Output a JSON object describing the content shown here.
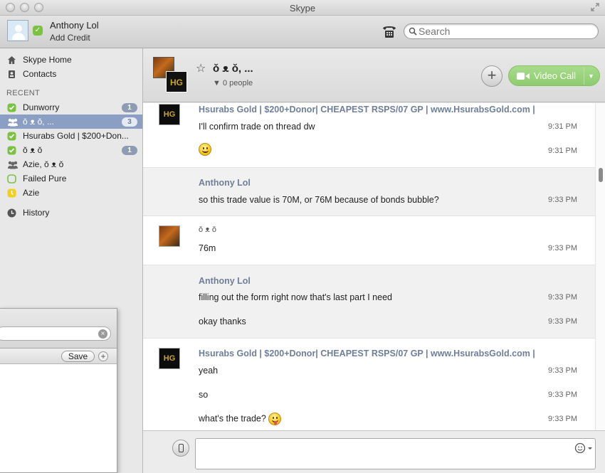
{
  "window": {
    "title": "Skype"
  },
  "header": {
    "user_name": "Anthony Lol",
    "add_credit": "Add Credit",
    "search_placeholder": "Search"
  },
  "sidebar": {
    "nav": [
      {
        "label": "Skype Home",
        "icon": "home-icon"
      },
      {
        "label": "Contacts",
        "icon": "contacts-icon"
      }
    ],
    "recent_label": "RECENT",
    "recent": [
      {
        "label": "Dunworry",
        "badge": "1",
        "icon": "online-status-icon"
      },
      {
        "label": "ǒ ᴥ ǒ, ...",
        "badge": "3",
        "icon": "group-icon",
        "selected": true
      },
      {
        "label": "Hsurabs Gold | $200+Don...",
        "badge": "",
        "icon": "online-status-icon"
      },
      {
        "label": "ǒ ᴥ ǒ",
        "badge": "1",
        "icon": "online-status-icon"
      },
      {
        "label": "Azie, ǒ ᴥ ǒ",
        "badge": "",
        "icon": "group-icon"
      },
      {
        "label": "Failed Pure",
        "badge": "",
        "icon": "offline-status-icon"
      },
      {
        "label": "Azie",
        "badge": "",
        "icon": "away-status-icon"
      }
    ],
    "history": "History"
  },
  "float_panel": {
    "save_label": "Save",
    "add_label": "+",
    "clear_label": "×"
  },
  "conversation": {
    "title": "ǒ ᴥ ǒ, ...",
    "people": "0 people",
    "add_label": "+",
    "video_call_label": "Video Call",
    "messages": [
      {
        "sender": "Hsurabs Gold | $200+Donor| CHEAPEST RSPS/07 GP | www.HsurabsGold.com |",
        "lines": [
          {
            "text": "I'll confirm trade on thread dw",
            "time": "9:31 PM"
          },
          {
            "text": "",
            "emoticon": "smile",
            "time": "9:31 PM"
          }
        ]
      },
      {
        "sender": "Anthony Lol",
        "lines": [
          {
            "text": "so this trade value is 70M, or 76M because of bonds bubble?",
            "time": "9:33 PM"
          }
        ]
      },
      {
        "sender": "ǒ ᴥ ǒ",
        "lines": [
          {
            "text": "76m",
            "time": "9:33 PM"
          }
        ]
      },
      {
        "sender": "Anthony Lol",
        "lines": [
          {
            "text": "filling out the form right now that's last part I need",
            "time": "9:33 PM"
          },
          {
            "text": "okay thanks",
            "time": "9:33 PM"
          }
        ]
      },
      {
        "sender": "Hsurabs Gold | $200+Donor| CHEAPEST RSPS/07 GP | www.HsurabsGold.com |",
        "lines": [
          {
            "text": "yeah",
            "time": "9:33 PM"
          },
          {
            "text": "so",
            "time": "9:33 PM"
          },
          {
            "text": "what's the trade?",
            "emoticon": "tongue",
            "time": "9:33 PM"
          }
        ]
      }
    ]
  },
  "colors": {
    "accent_green": "#8fcb6f",
    "selected_row": "#8b9ec4",
    "sender_name": "#6f7e9a",
    "online": "#7cc242"
  }
}
